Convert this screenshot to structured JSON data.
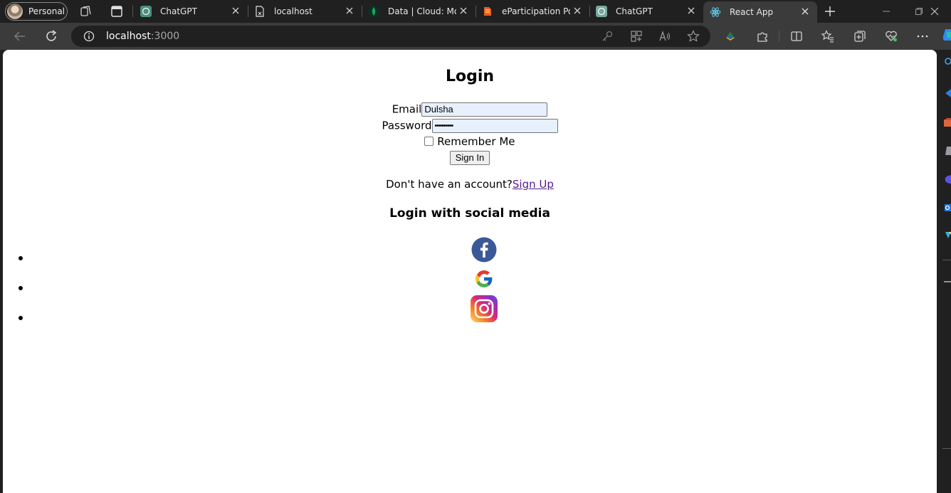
{
  "browser": {
    "profile_label": "Personal",
    "tabs": [
      {
        "title": "ChatGPT",
        "active": false
      },
      {
        "title": "localhost",
        "active": false
      },
      {
        "title": "Data | Cloud: Mon",
        "active": false
      },
      {
        "title": "eParticipation Por",
        "active": false
      },
      {
        "title": "ChatGPT",
        "active": false
      },
      {
        "title": "React App",
        "active": true
      }
    ],
    "url_host": "localhost",
    "url_port": ":3000"
  },
  "page": {
    "title": "Login",
    "email_label": "Email",
    "email_value": "Dulsha",
    "password_label": "Password",
    "password_value": "•••••••••",
    "remember_label": "Remember Me",
    "sign_in_label": "Sign In",
    "no_account_text": "Don't have an account?",
    "sign_up_label": "Sign Up",
    "social_heading": "Login with social media",
    "social_icons": [
      "facebook-icon",
      "google-icon",
      "instagram-icon"
    ]
  },
  "colors": {
    "accent_link": "#551a8b",
    "facebook": "#3b5998",
    "autofill_bg": "#e8f0fe",
    "browser_bg": "#202020",
    "toolbar_bg": "#3b3b3b"
  }
}
